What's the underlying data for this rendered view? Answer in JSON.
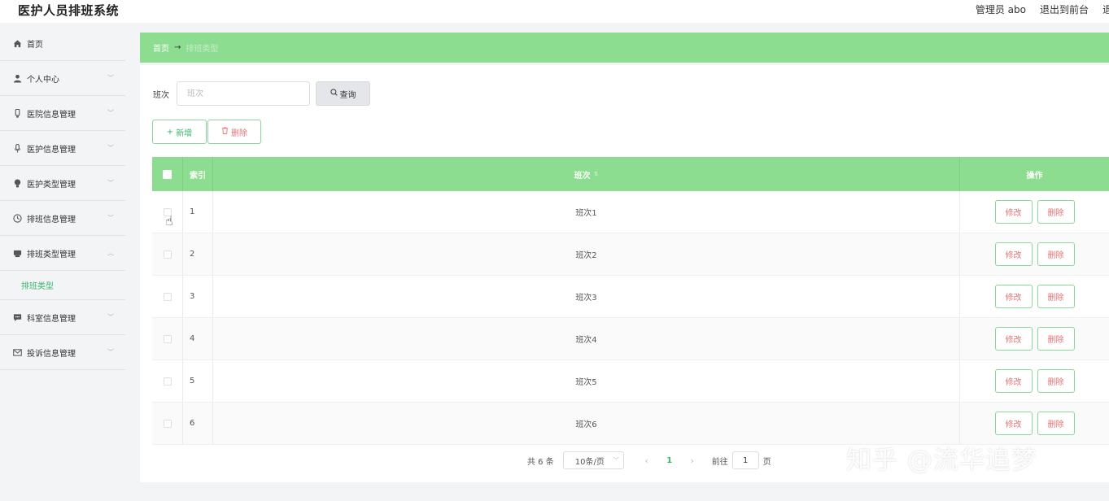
{
  "app": {
    "title": "医护人员排班系统"
  },
  "topbar": {
    "user_label": "管理员 abo",
    "front_label": "退出到前台",
    "logout_label": "退"
  },
  "sidebar": {
    "items": [
      {
        "label": "首页",
        "icon": "home-icon"
      },
      {
        "label": "个人中心",
        "icon": "user-icon"
      },
      {
        "label": "医院信息管理",
        "icon": "device-icon"
      },
      {
        "label": "医护信息管理",
        "icon": "mic-icon"
      },
      {
        "label": "医护类型管理",
        "icon": "bulb-icon"
      },
      {
        "label": "排班信息管理",
        "icon": "clock-icon"
      },
      {
        "label": "排班类型管理",
        "icon": "printer-icon"
      },
      {
        "label": "科室信息管理",
        "icon": "chat-icon"
      },
      {
        "label": "投诉信息管理",
        "icon": "mail-icon"
      }
    ],
    "subitem": "排班类型"
  },
  "breadcrumb": {
    "home": "首页",
    "arrow": "→",
    "current": "排班类型"
  },
  "search": {
    "label": "班次",
    "placeholder": "班次",
    "button": "查询"
  },
  "actions": {
    "add": "新增",
    "delete": "删除"
  },
  "table": {
    "headers": {
      "index": "索引",
      "name": "班次",
      "op": "操作"
    },
    "rows": [
      {
        "index": "1",
        "name": "班次1"
      },
      {
        "index": "2",
        "name": "班次2"
      },
      {
        "index": "3",
        "name": "班次3"
      },
      {
        "index": "4",
        "name": "班次4"
      },
      {
        "index": "5",
        "name": "班次5"
      },
      {
        "index": "6",
        "name": "班次6"
      }
    ],
    "edit_label": "修改",
    "delete_label": "删除"
  },
  "pagination": {
    "total": "共 6 条",
    "page_size": "10条/页",
    "current_page": "1",
    "goto_label": "前往",
    "goto_value": "1",
    "page_unit": "页"
  },
  "watermark": "知乎 @流华追梦",
  "colors": {
    "accent": "#8cdd8f",
    "accent_text": "#3bb56b",
    "danger": "#e37575"
  }
}
